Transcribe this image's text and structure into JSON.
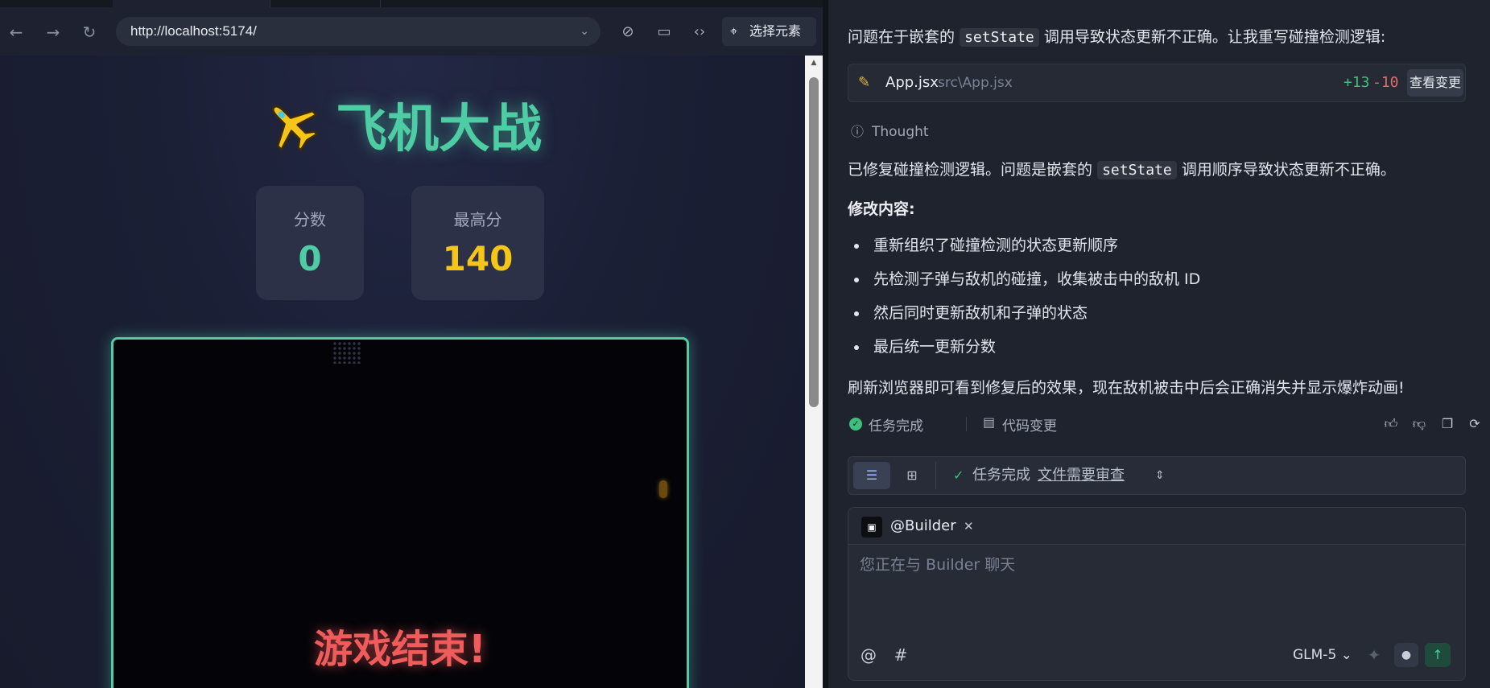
{
  "browser": {
    "url": "http://localhost:5174/",
    "pick_element_label": "选择元素",
    "page": {
      "title": "飞机大战",
      "score_label": "分数",
      "score_value": "0",
      "best_label": "最高分",
      "best_value": "140",
      "game_over_text": "游戏结束!",
      "colors": {
        "accent": "#4ecda5",
        "score": "#4ecda5",
        "best": "#f5c518",
        "game_over": "#f05b5b"
      }
    }
  },
  "chat": {
    "intro_pre": "问题在于嵌套的",
    "intro_code": "setState",
    "intro_post": "调用导致状态更新不正确。让我重写碰撞检测逻辑:",
    "file_card": {
      "name": "App.jsx",
      "path": "src\\App.jsx",
      "added": "+13",
      "removed": "-10",
      "view_label": "查看变更"
    },
    "thought_label": "Thought",
    "fixed_pre": "已修复碰撞检测逻辑。问题是嵌套的",
    "fixed_code": "setState",
    "fixed_post": "调用顺序导致状态更新不正确。",
    "changes_heading": "修改内容:",
    "bullets": [
      "重新组织了碰撞检测的状态更新顺序",
      "先检测子弹与敌机的碰撞，收集被击中的敌机 ID",
      "然后同时更新敌机和子弹的状态",
      "最后统一更新分数"
    ],
    "refresh_note": "刷新浏览器即可看到修复后的效果，现在敌机被击中后会正确消失并显示爆炸动画!",
    "status": {
      "task_done": "任务完成",
      "code_change": "代码变更"
    },
    "review_bar": {
      "status": "任务完成",
      "link": "文件需要审查"
    },
    "composer": {
      "agent": "@Builder",
      "placeholder": "您正在与 Builder 聊天",
      "model": "GLM-5"
    }
  }
}
